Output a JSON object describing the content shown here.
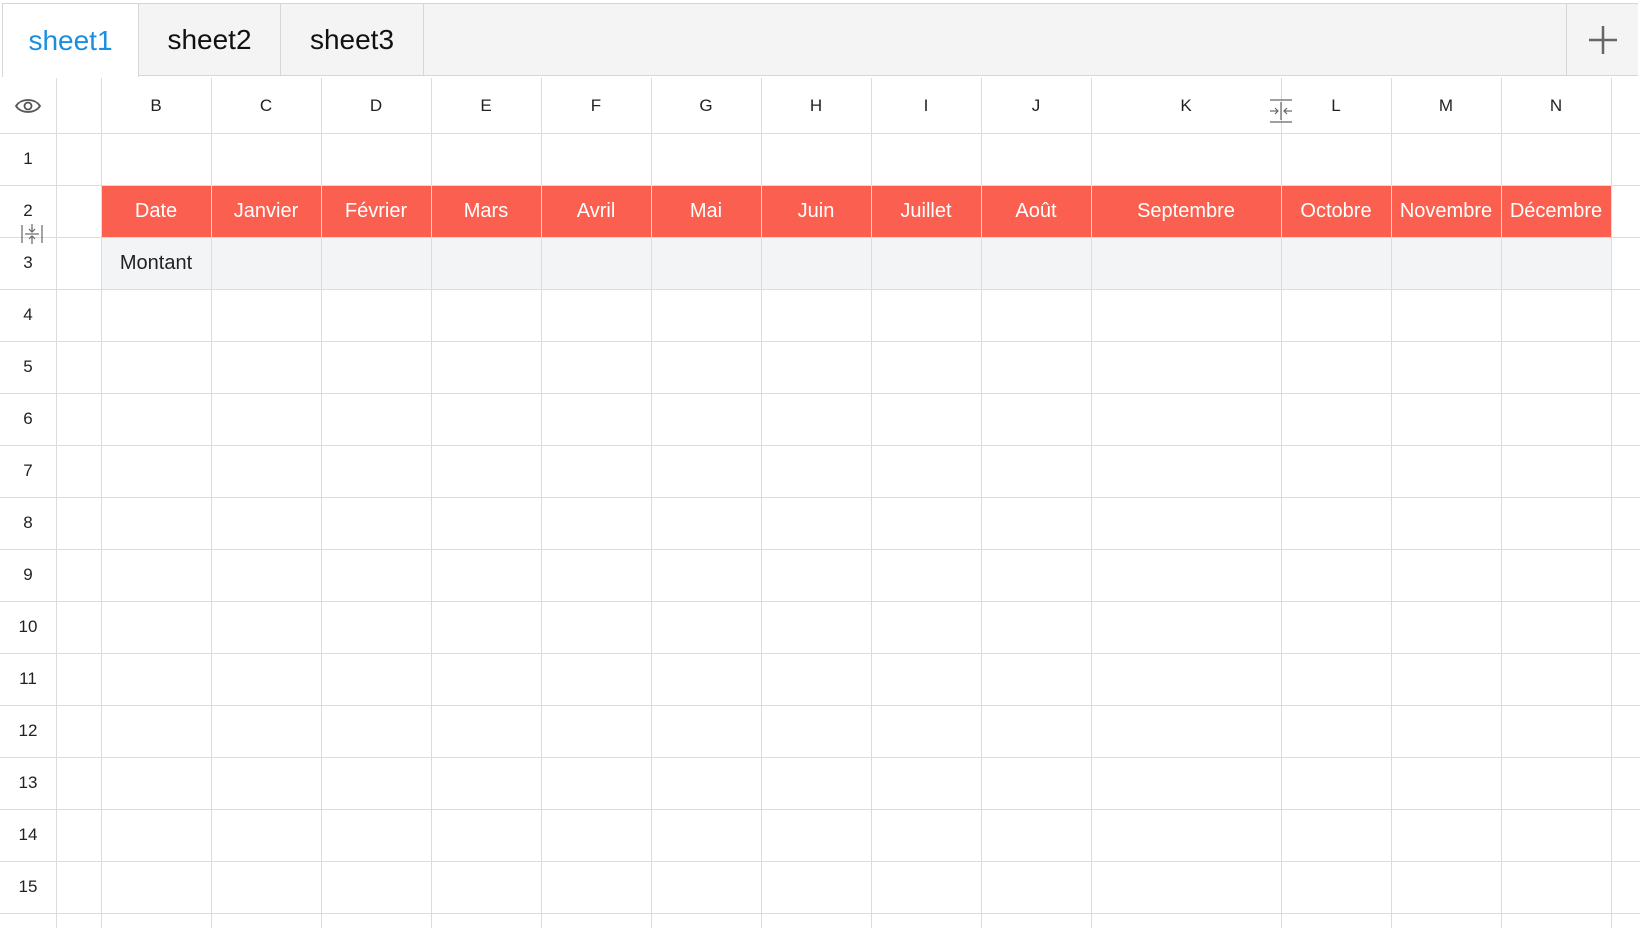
{
  "tabs": [
    {
      "label": "sheet1",
      "active": true
    },
    {
      "label": "sheet2",
      "active": false
    },
    {
      "label": "sheet3",
      "active": false
    }
  ],
  "add_tab_icon": "plus-icon",
  "column_letters": [
    "B",
    "C",
    "D",
    "E",
    "F",
    "G",
    "H",
    "I",
    "J",
    "K",
    "L",
    "M",
    "N"
  ],
  "row_numbers": [
    "1",
    "2",
    "3",
    "4",
    "5",
    "6",
    "7",
    "8",
    "9",
    "10",
    "11",
    "12",
    "13",
    "14",
    "15"
  ],
  "table": {
    "header_row": [
      "Date",
      "Janvier",
      "Février",
      "Mars",
      "Avril",
      "Mai",
      "Juin",
      "Juillet",
      "Août",
      "Septembre",
      "Octobre",
      "Novembre",
      "Décembre"
    ],
    "value_row": [
      "Montant",
      "",
      "",
      "",
      "",
      "",
      "",
      "",
      "",
      "",
      "",
      "",
      ""
    ]
  },
  "colors": {
    "active_tab_text": "#1a8fdf",
    "header_fill": "#fa5f50",
    "value_row_fill": "#f3f4f6",
    "grid_line": "#dcdcdc"
  },
  "icons": {
    "corner": "eye-icon",
    "row_resize": "row-resize-icon",
    "column_resize": "column-resize-icon"
  }
}
